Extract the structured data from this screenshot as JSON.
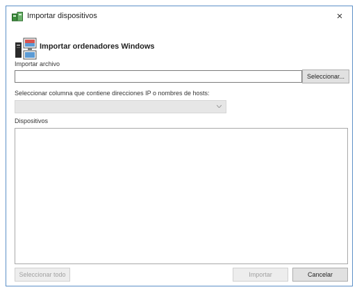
{
  "window": {
    "title": "Importar dispositivos",
    "close_glyph": "×"
  },
  "header": {
    "title": "Importar ordenadores Windows",
    "icon": "computers-import-icon"
  },
  "form": {
    "file_label": "Importar archivo",
    "file_value": "",
    "browse_label": "Seleccionar...",
    "column_label": "Seleccionar columna que contiene direcciones IP o nombres de hosts:",
    "column_value": "",
    "devices_label": "Dispositivos",
    "devices": []
  },
  "footer": {
    "select_all_label": "Seleccionar todo",
    "import_label": "Importar",
    "cancel_label": "Cancelar"
  },
  "colors": {
    "window_border": "#5b8fc7",
    "button_bg": "#e1e1e1",
    "disabled_text": "#a0a0a0"
  }
}
